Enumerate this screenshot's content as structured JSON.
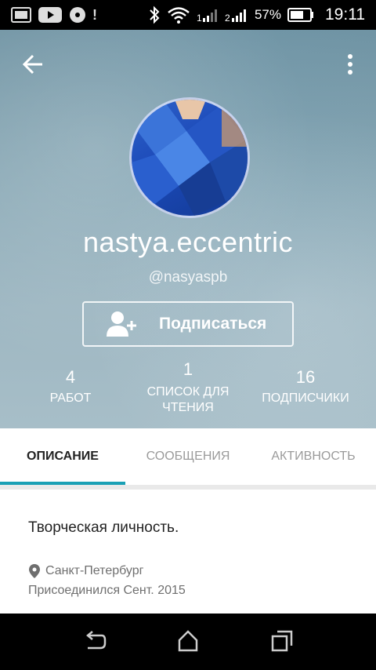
{
  "status_bar": {
    "battery_pct": "57%",
    "time": "19:11",
    "icons": [
      "image-icon",
      "youtube-icon",
      "disc-icon",
      "bluetooth-icon",
      "wifi-icon",
      "signal-1-icon",
      "signal-2-icon",
      "battery-icon"
    ]
  },
  "profile": {
    "username": "nastya.eccentric",
    "handle": "@nasyaspb",
    "follow_label": "Подписаться",
    "stats": [
      {
        "value": "4",
        "label": "РАБОТ"
      },
      {
        "value": "1",
        "label_line1": "СПИСОК ДЛЯ",
        "label_line2": "ЧТЕНИЯ"
      },
      {
        "value": "16",
        "label": "ПОДПИСЧИКИ"
      }
    ]
  },
  "tabs": [
    {
      "label": "ОПИСАНИЕ",
      "active": true
    },
    {
      "label": "СООБЩЕНИЯ",
      "active": false
    },
    {
      "label": "АКТИВНОСТЬ",
      "active": false
    }
  ],
  "about": {
    "bio": "Творческая личность.",
    "location": "Санкт-Петербург",
    "joined": "Присоединился Сент. 2015"
  },
  "colors": {
    "accent": "#1aa0b5",
    "header_bg": "#8aa9b6",
    "text_muted": "#6f6f6f"
  }
}
